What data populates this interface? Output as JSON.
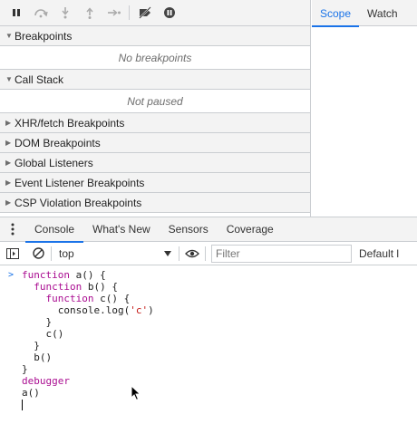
{
  "toolbar": {
    "buttons": [
      "pause-icon",
      "step-over-icon",
      "step-into-icon",
      "step-out-icon",
      "step-icon",
      "deactivate-breakpoints-icon",
      "pause-on-exceptions-icon"
    ]
  },
  "sections": {
    "breakpoints": {
      "title": "Breakpoints",
      "body": "No breakpoints"
    },
    "call_stack": {
      "title": "Call Stack",
      "body": "Not paused"
    },
    "xhr": {
      "title": "XHR/fetch Breakpoints"
    },
    "dom": {
      "title": "DOM Breakpoints"
    },
    "global": {
      "title": "Global Listeners"
    },
    "event": {
      "title": "Event Listener Breakpoints"
    },
    "csp": {
      "title": "CSP Violation Breakpoints"
    }
  },
  "right_tabs": {
    "scope": "Scope",
    "watch": "Watch"
  },
  "drawer": {
    "tabs": {
      "console": "Console",
      "whats_new": "What's New",
      "sensors": "Sensors",
      "coverage": "Coverage"
    },
    "context": "top",
    "filter_placeholder": "Filter",
    "levels": "Default l"
  },
  "code": {
    "prompt": ">",
    "l1_kw": "function",
    "l1_rest": " a() {",
    "l2_kw": "function",
    "l2_rest": " b() {",
    "l3_kw": "function",
    "l3_rest": " c() {",
    "l4_a": "console.log(",
    "l4_str": "'c'",
    "l4_b": ")",
    "l5": "}",
    "l6": "c()",
    "l7": "}",
    "l8": "b()",
    "l9": "}",
    "l10_kw": "debugger",
    "l11": "a()"
  },
  "colors": {
    "accent": "#1a73e8",
    "keyword": "#aa0d91",
    "string": "#c41a16"
  }
}
